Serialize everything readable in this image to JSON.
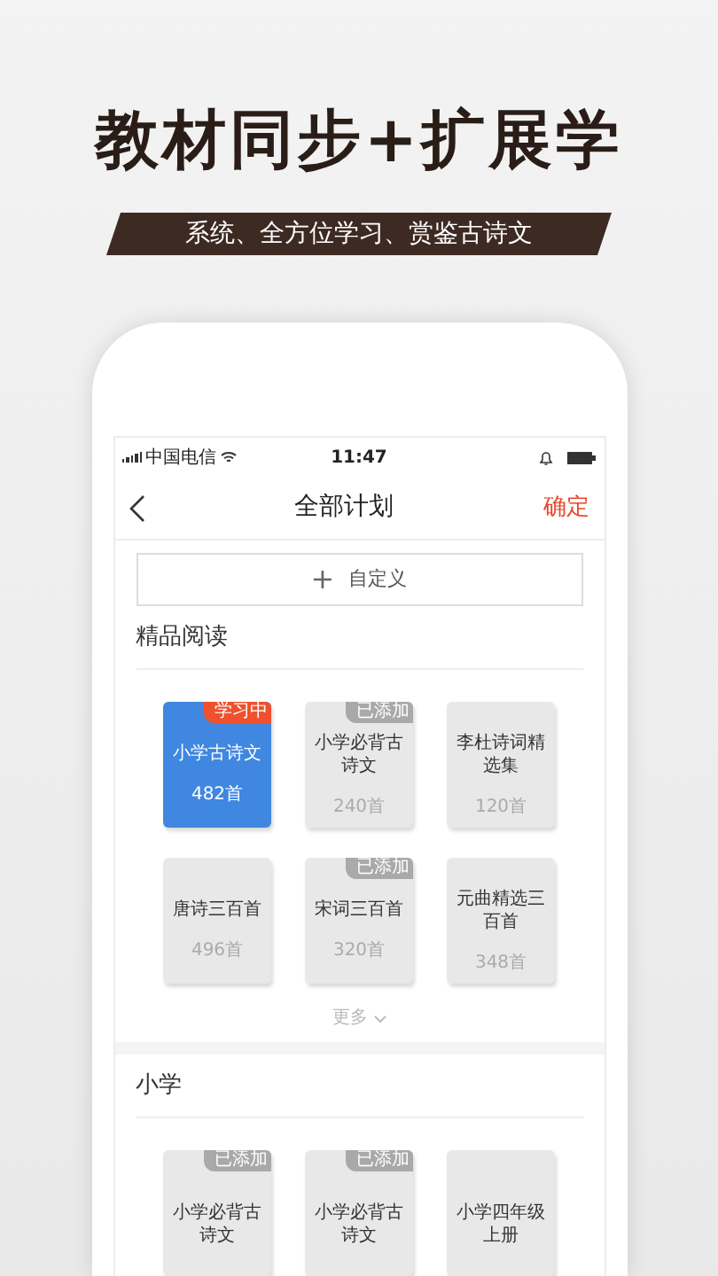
{
  "headline": "教材同步+扩展学",
  "tagline": "系统、全方位学习、赏鉴古诗文",
  "status_bar": {
    "carrier": "中国电信",
    "time": "11:47"
  },
  "nav": {
    "title": "全部计划",
    "confirm": "确定"
  },
  "custom_button": {
    "icon": "+",
    "label": "自定义"
  },
  "sections": [
    {
      "title": "精品阅读",
      "more": "更多",
      "cards": [
        {
          "title": "小学古诗文",
          "count": "482首",
          "selected": true,
          "ribbon": "学习中"
        },
        {
          "title": "小学必背古诗文",
          "count": "240首",
          "selected": false,
          "ribbon": "已添加"
        },
        {
          "title": "李杜诗词精选集",
          "count": "120首",
          "selected": false
        },
        {
          "title": "唐诗三百首",
          "count": "496首",
          "selected": false
        },
        {
          "title": "宋词三百首",
          "count": "320首",
          "selected": false,
          "ribbon": "已添加"
        },
        {
          "title": "元曲精选三百首",
          "count": "348首",
          "selected": false
        }
      ]
    },
    {
      "title": "小学",
      "cards": [
        {
          "title": "小学必背古诗文",
          "selected": false,
          "ribbon": "已添加"
        },
        {
          "title": "小学必背古诗文",
          "selected": false,
          "ribbon": "已添加"
        },
        {
          "title": "小学四年级上册",
          "selected": false
        }
      ]
    }
  ]
}
